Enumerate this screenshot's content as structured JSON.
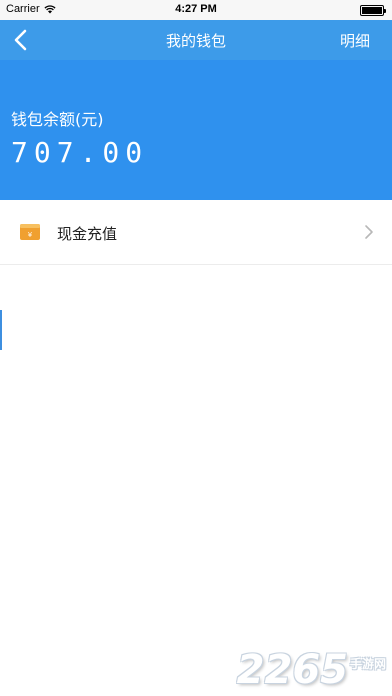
{
  "status_bar": {
    "carrier": "Carrier",
    "time": "4:27 PM",
    "wifi_icon": "wifi-icon",
    "battery_icon": "battery-full-icon"
  },
  "nav": {
    "back_icon": "chevron-left-icon",
    "title": "我的钱包",
    "details_label": "明细"
  },
  "balance": {
    "label": "钱包余额(元)",
    "amount": "707.00"
  },
  "menu": {
    "items": [
      {
        "icon": "wallet-icon",
        "label": "现金充值",
        "trailing_icon": "chevron-right-icon"
      }
    ]
  },
  "watermark": {
    "logo": "2265",
    "text": "手游网"
  },
  "colors": {
    "nav_bar": "#3d9be9",
    "balance_panel": "#2f91ee",
    "wallet_icon": "#f0a030",
    "background": "#ffffff"
  }
}
